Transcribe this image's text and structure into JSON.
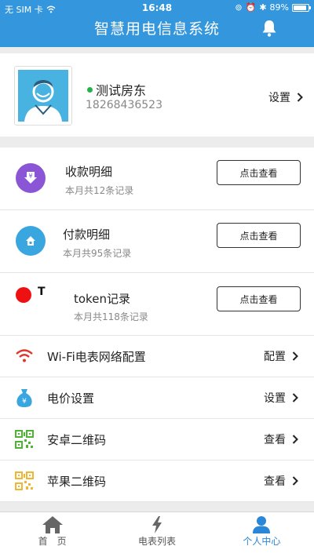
{
  "status_bar": {
    "carrier": "无 SIM 卡",
    "time": "16:48",
    "battery": "89%",
    "battery_level": 0.89
  },
  "app": {
    "title": "智慧用电信息系统"
  },
  "profile": {
    "name": "测试房东",
    "phone": "18268436523",
    "setting_label": "设置"
  },
  "records": [
    {
      "title": "收款明细",
      "subtitle": "本月共12条记录",
      "button": "点击查看",
      "icon": "receive-money-icon",
      "color": "#8b56d6"
    },
    {
      "title": "付款明细",
      "subtitle": "本月共95条记录",
      "button": "点击查看",
      "icon": "payment-home-icon",
      "color": "#3aa6e0"
    },
    {
      "title": "token记录",
      "subtitle": "本月共118条记录",
      "button": "点击查看",
      "icon": "token-icon",
      "color": "#ee1111"
    }
  ],
  "token_glyph": "T",
  "settings": [
    {
      "title": "Wi-Fi电表网络配置",
      "action": "配置",
      "icon": "wifi-icon"
    },
    {
      "title": "电价设置",
      "action": "设置",
      "icon": "money-bag-icon"
    },
    {
      "title": "安卓二维码",
      "action": "查看",
      "icon": "qr-code-android-icon"
    },
    {
      "title": "苹果二维码",
      "action": "查看",
      "icon": "qr-code-apple-icon"
    }
  ],
  "tabs": [
    {
      "label": "首　页",
      "icon": "home-icon",
      "active": false
    },
    {
      "label": "电表列表",
      "icon": "lightning-icon",
      "active": false
    },
    {
      "label": "个人中心",
      "icon": "person-icon",
      "active": true
    }
  ],
  "colors": {
    "primary": "#3496dc",
    "active_tab": "#2a86d6",
    "online": "#24b24a",
    "wifi": "#e0352b",
    "android_qr": "#4cb62f",
    "apple_qr": "#f2b532",
    "money_bag": "#3aa6e0"
  }
}
